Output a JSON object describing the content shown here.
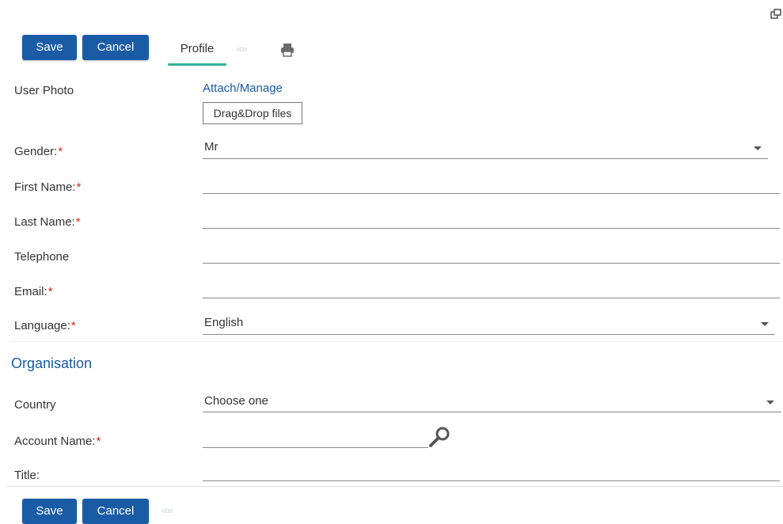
{
  "toolbar": {
    "save_label": "Save",
    "cancel_label": "Cancel",
    "tab_profile": "Profile",
    "nav_chevrons": "«»"
  },
  "form": {
    "user_photo": {
      "label": "User Photo",
      "attach_link": "Attach/Manage",
      "dropzone": "Drag&Drop files"
    },
    "gender": {
      "label": "Gender:",
      "required": "*",
      "value": "Mr"
    },
    "first_name": {
      "label": "First Name:",
      "required": "*",
      "value": ""
    },
    "last_name": {
      "label": "Last Name:",
      "required": "*",
      "value": ""
    },
    "telephone": {
      "label": "Telephone",
      "value": ""
    },
    "email": {
      "label": "Email:",
      "required": "*",
      "value": ""
    },
    "language": {
      "label": "Language:",
      "required": "*",
      "value": "English"
    }
  },
  "organisation": {
    "title": "Organisation",
    "country": {
      "label": "Country",
      "value": "Choose one"
    },
    "account_name": {
      "label": "Account Name:",
      "required": "*",
      "value": ""
    },
    "job_title": {
      "label": "Title:",
      "value": ""
    }
  },
  "icons": {
    "popout": "popout-icon",
    "print": "print-icon",
    "search": "search-icon",
    "dropdown": "chevron-down-icon"
  },
  "colors": {
    "primary": "#1a5ba6",
    "tab_accent": "#2fb39a",
    "required": "#d9221c"
  }
}
